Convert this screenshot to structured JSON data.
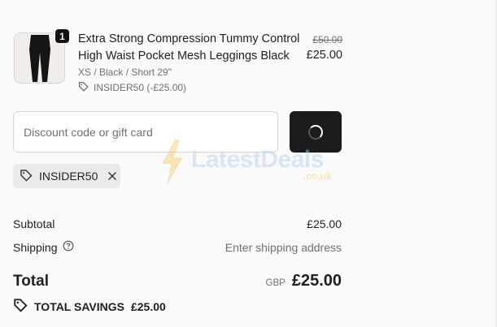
{
  "product": {
    "quantity": "1",
    "title": "Extra Strong Compression Tummy Control High Waist Pocket Mesh Leggings Black",
    "variant": "XS / Black / Short 29\"",
    "discount_note": "INSIDER50 (-£25.00)",
    "original_price": "£50.00",
    "price": "£25.00",
    "image_icon": "leggings-product-image"
  },
  "discount": {
    "placeholder": "Discount code or gift card",
    "value": "",
    "apply_state": "loading"
  },
  "watermark": {
    "main": "LatestDeals",
    "sub": ".co.uk"
  },
  "applied_code": {
    "code": "INSIDER50"
  },
  "summary": {
    "subtotal_label": "Subtotal",
    "subtotal_value": "£25.00",
    "shipping_label": "Shipping",
    "shipping_value": "Enter shipping address",
    "total_label": "Total",
    "currency": "GBP",
    "total_value": "£25.00",
    "savings_label": "TOTAL SAVINGS",
    "savings_value": "£25.00"
  },
  "colors": {
    "background": "#fafafa",
    "button": "#1b1b1b",
    "muted_text": "#707070",
    "chip_bg": "#ebebeb"
  }
}
